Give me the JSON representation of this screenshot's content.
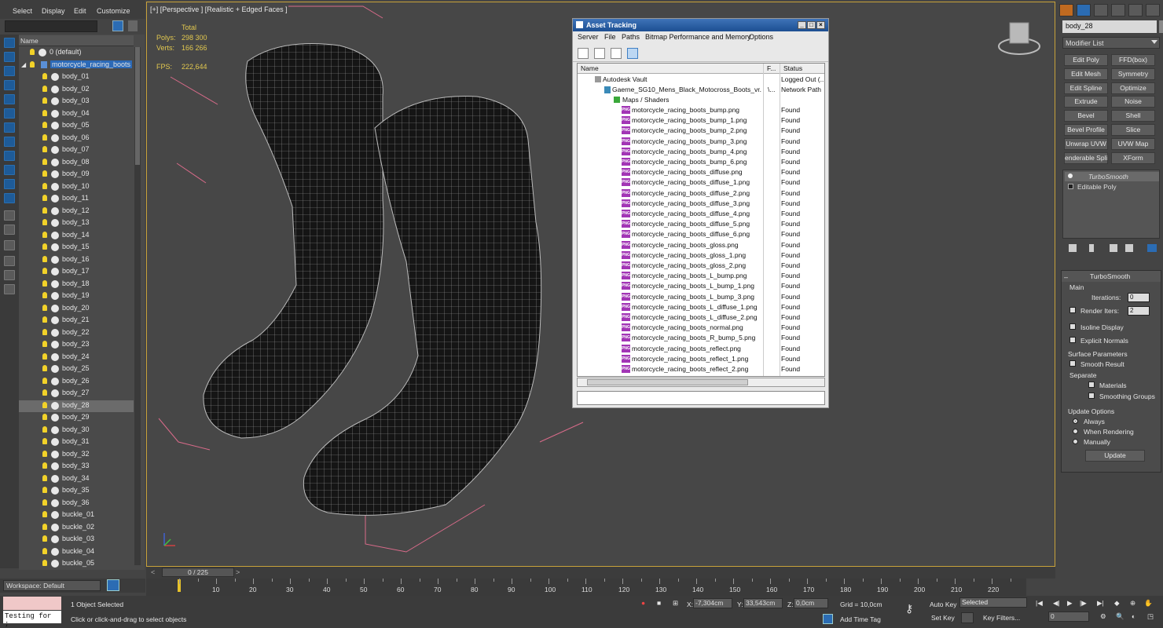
{
  "menu": {
    "select": "Select",
    "display": "Display",
    "edit": "Edit",
    "customize": "Customize"
  },
  "explorer": {
    "header_name": "Name",
    "root_items": [
      "0 (default)",
      "motorcycle_racing_boots"
    ],
    "items": [
      "body_01",
      "body_02",
      "body_03",
      "body_04",
      "body_05",
      "body_06",
      "body_07",
      "body_08",
      "body_09",
      "body_10",
      "body_11",
      "body_12",
      "body_13",
      "body_14",
      "body_15",
      "body_16",
      "body_17",
      "body_18",
      "body_19",
      "body_20",
      "body_21",
      "body_22",
      "body_23",
      "body_24",
      "body_25",
      "body_26",
      "body_27",
      "body_28",
      "body_29",
      "body_30",
      "body_31",
      "body_32",
      "body_33",
      "body_34",
      "body_35",
      "body_36",
      "buckle_01",
      "buckle_02",
      "buckle_03",
      "buckle_04",
      "buckle_05"
    ],
    "workspace": "Workspace: Default"
  },
  "viewport": {
    "label": "[+] [Perspective ] [Realistic + Edged Faces ]",
    "total_label": "Total",
    "polys_label": "Polys:",
    "polys_value": "298 300",
    "verts_label": "Verts:",
    "verts_value": "166 266",
    "fps_label": "FPS:",
    "fps_value": "222,644"
  },
  "asset_tracking": {
    "title": "Asset Tracking",
    "menu": [
      "Server",
      "File",
      "Paths",
      "Bitmap Performance and Memory",
      "Options"
    ],
    "col_name": "Name",
    "col_full": "F...",
    "col_status": "Status",
    "vault": {
      "name": "Autodesk Vault",
      "status": "Logged Out (..."
    },
    "file": {
      "name": "Gaerne_SG10_Mens_Black_Motocross_Boots_vr...",
      "path": "\\...",
      "status": "Network Path"
    },
    "maps_folder": "Maps / Shaders",
    "maps": [
      "motorcycle_racing_boots_bump.png",
      "motorcycle_racing_boots_bump_1.png",
      "motorcycle_racing_boots_bump_2.png",
      "motorcycle_racing_boots_bump_3.png",
      "motorcycle_racing_boots_bump_4.png",
      "motorcycle_racing_boots_bump_6.png",
      "motorcycle_racing_boots_diffuse.png",
      "motorcycle_racing_boots_diffuse_1.png",
      "motorcycle_racing_boots_diffuse_2.png",
      "motorcycle_racing_boots_diffuse_3.png",
      "motorcycle_racing_boots_diffuse_4.png",
      "motorcycle_racing_boots_diffuse_5.png",
      "motorcycle_racing_boots_diffuse_6.png",
      "motorcycle_racing_boots_gloss.png",
      "motorcycle_racing_boots_gloss_1.png",
      "motorcycle_racing_boots_gloss_2.png",
      "motorcycle_racing_boots_L_bump.png",
      "motorcycle_racing_boots_L_bump_1.png",
      "motorcycle_racing_boots_L_bump_3.png",
      "motorcycle_racing_boots_L_diffuse_1.png",
      "motorcycle_racing_boots_L_diffuse_2.png",
      "motorcycle_racing_boots_normal.png",
      "motorcycle_racing_boots_R_bump_5.png",
      "motorcycle_racing_boots_reflect.png",
      "motorcycle_racing_boots_reflect_1.png",
      "motorcycle_racing_boots_reflect_2.png"
    ],
    "found": "Found",
    "png_icon": "PNG"
  },
  "command_panel": {
    "object_name": "body_28",
    "modifier_list": "Modifier List",
    "buttons": [
      "Edit Poly",
      "FFD(box)",
      "Edit Mesh",
      "Symmetry",
      "Edit Spline",
      "Optimize",
      "Extrude",
      "Noise",
      "Bevel",
      "Shell",
      "Bevel Profile",
      "Slice",
      "Unwrap UVW",
      "UVW Map",
      "enderable Splin",
      "XForm"
    ],
    "stack": [
      "TurboSmooth",
      "Editable Poly"
    ],
    "rollout": {
      "title": "TurboSmooth",
      "main": "Main",
      "iterations_label": "Iterations:",
      "iterations": "0",
      "render_iters_label": "Render Iters:",
      "render_iters": "2",
      "isoline": "Isoline Display",
      "explicit_normals": "Explicit Normals",
      "surface_params": "Surface Parameters",
      "smooth_result": "Smooth Result",
      "separate": "Separate",
      "materials": "Materials",
      "smoothing_groups": "Smoothing Groups",
      "update_options": "Update Options",
      "always": "Always",
      "when_rendering": "When Rendering",
      "manually": "Manually",
      "update": "Update"
    }
  },
  "timeline": {
    "frame": "0 / 225",
    "ticks": [
      "10",
      "20",
      "30",
      "40",
      "50",
      "60",
      "70",
      "80",
      "90",
      "100",
      "110",
      "120",
      "130",
      "140",
      "150",
      "160",
      "170",
      "180",
      "190",
      "200",
      "210",
      "220"
    ]
  },
  "status": {
    "maxscript": "Testing for ;",
    "selected": "1 Object Selected",
    "prompt": "Click or click-and-drag to select objects",
    "x_label": "X:",
    "x": "-7,304cm",
    "y_label": "Y:",
    "y": "33,543cm",
    "z_label": "Z:",
    "z": "0,0cm",
    "grid": "Grid = 10,0cm",
    "add_time_tag": "Add Time Tag",
    "auto_key": "Auto Key",
    "set_key": "Set Key",
    "selected_set": "Selected",
    "key_filters": "Key Filters...",
    "frame_field": "0"
  }
}
